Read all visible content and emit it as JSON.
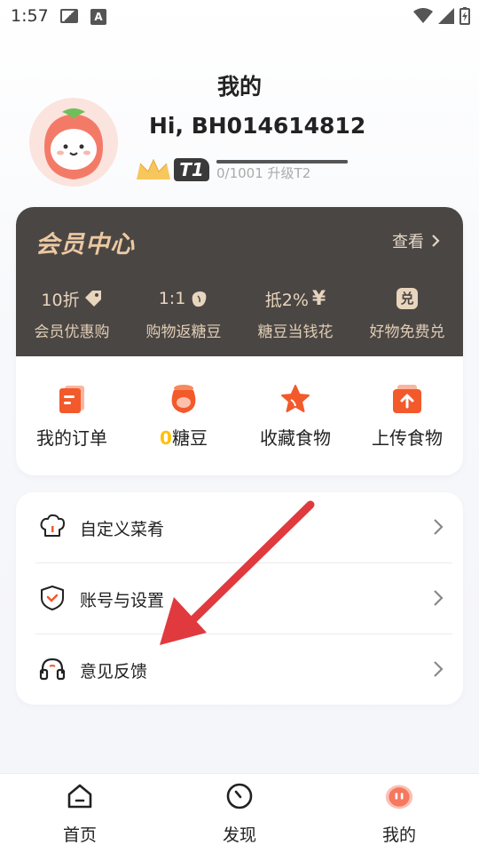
{
  "status_bar": {
    "time": "1:57"
  },
  "header": {
    "title": "我的"
  },
  "profile": {
    "greeting": "Hi, BH014614812",
    "tier": "T1",
    "progress_text": "0/1001 升级T2",
    "progress_value": 0
  },
  "member": {
    "title": "会员中心",
    "view_label": "查看",
    "perks": [
      {
        "value": "10折",
        "label": "会员优惠购",
        "icon": "tag-icon"
      },
      {
        "value": "1:1",
        "label": "购物返糖豆",
        "icon": "bean-icon"
      },
      {
        "value": "抵2%",
        "label": "糖豆当钱花",
        "icon": "yen-icon"
      },
      {
        "value": "",
        "label": "好物免费兑",
        "icon": "exchange-icon",
        "badge": "兑"
      }
    ]
  },
  "quick_actions": [
    {
      "label": "我的订单",
      "icon": "order-icon"
    },
    {
      "count": "0",
      "label": "糖豆",
      "icon": "bean-bag-icon"
    },
    {
      "label": "收藏食物",
      "icon": "star-icon"
    },
    {
      "label": "上传食物",
      "icon": "upload-icon"
    }
  ],
  "menu": [
    {
      "label": "自定义菜肴",
      "icon": "chef-hat-icon"
    },
    {
      "label": "账号与设置",
      "icon": "shield-icon"
    },
    {
      "label": "意见反馈",
      "icon": "headset-icon"
    }
  ],
  "bottom_nav": [
    {
      "label": "首页",
      "icon": "home-icon"
    },
    {
      "label": "发现",
      "icon": "compass-icon"
    },
    {
      "label": "我的",
      "icon": "mine-icon"
    }
  ],
  "colors": {
    "accent_orange": "#f25a2c",
    "member_bg": "#4a4644",
    "member_gold": "#ecc9a1",
    "bean_yellow": "#ffc107"
  }
}
